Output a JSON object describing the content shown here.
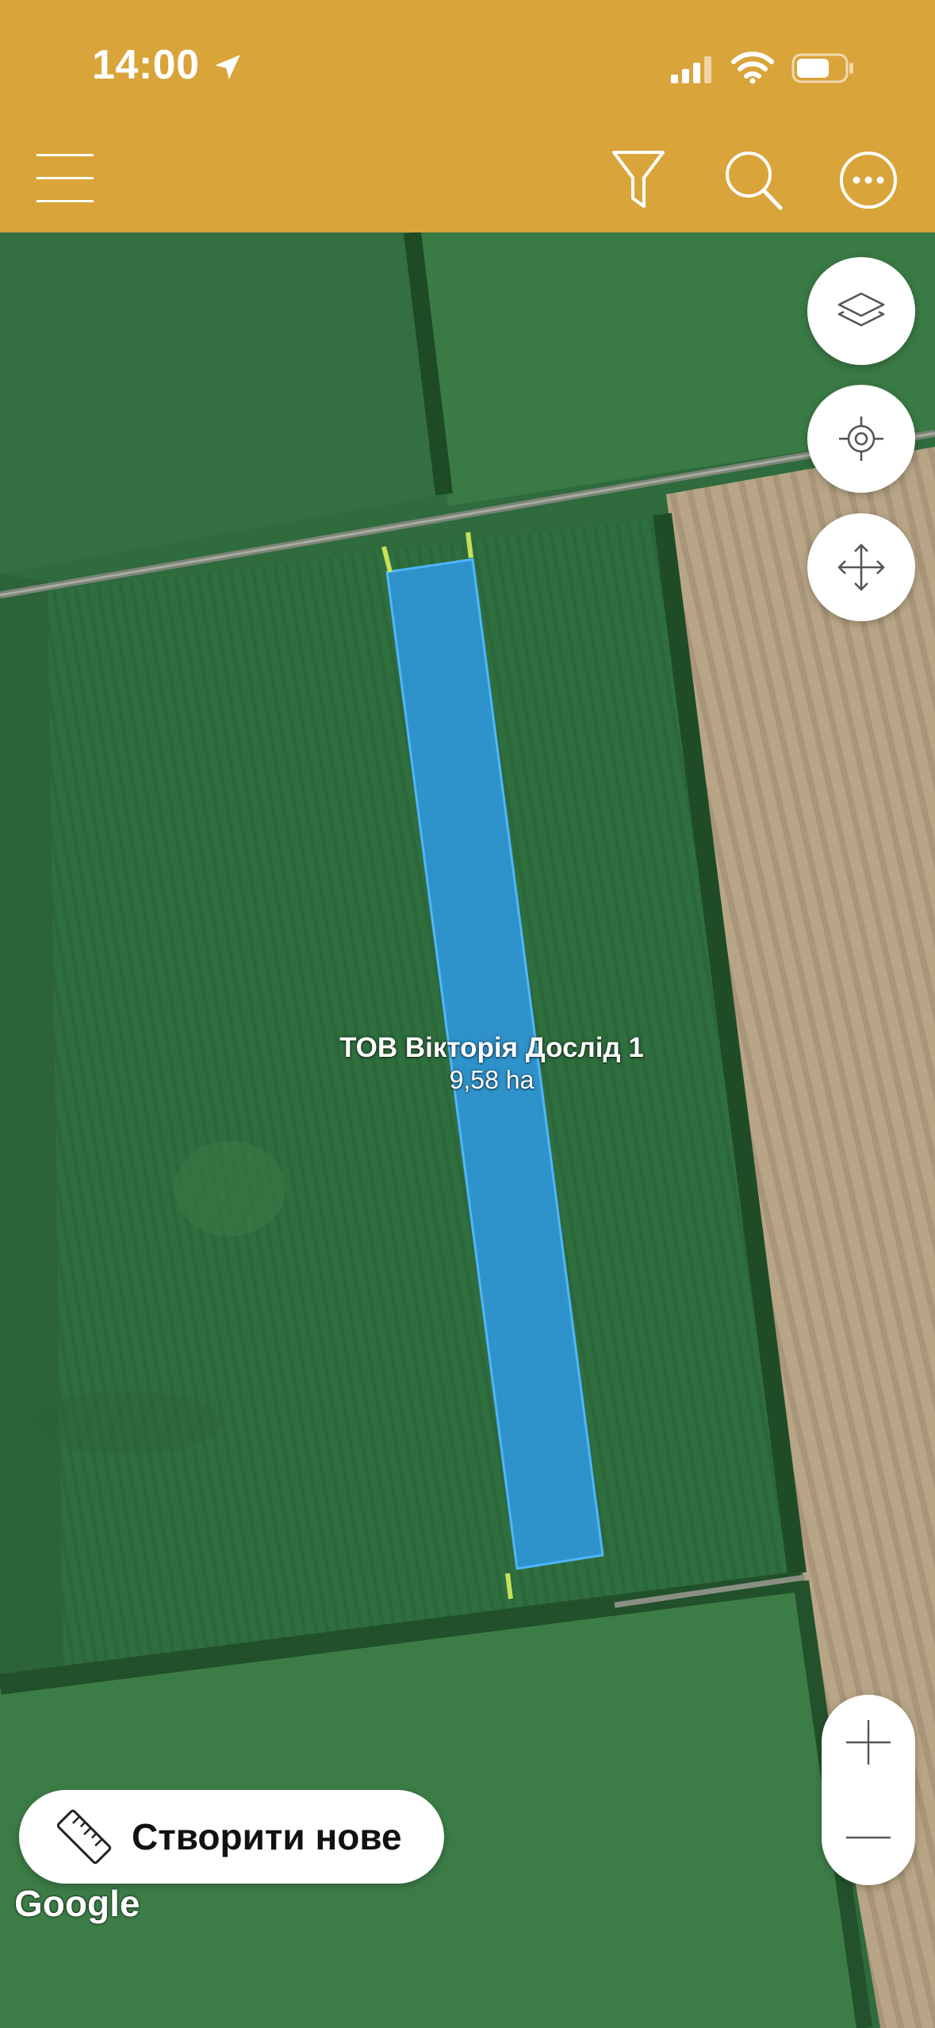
{
  "status_bar": {
    "time": "14:00",
    "icons": [
      "location-arrow-icon",
      "cellular-signal-icon",
      "wifi-icon",
      "battery-icon"
    ]
  },
  "toolbar": {
    "icons": [
      "hamburger-menu-icon",
      "filter-icon",
      "search-icon",
      "more-options-icon"
    ]
  },
  "map": {
    "field": {
      "name": "ТОВ Вікторія Дослід 1",
      "area": "9,58 ha",
      "fill_color": "#2f9bea"
    },
    "controls": {
      "icons": [
        "layers-icon",
        "locate-icon",
        "move-pan-icon",
        "zoom-in-icon",
        "zoom-out-icon"
      ]
    },
    "create_button": {
      "label": "Створити нове",
      "icon": "ruler-icon"
    },
    "attribution": "Google"
  },
  "colors": {
    "header": "#d9a43a",
    "field_selection": "#2f9bea",
    "crop_green": "#2f6b3c",
    "harvested_field": "#b9a688"
  }
}
